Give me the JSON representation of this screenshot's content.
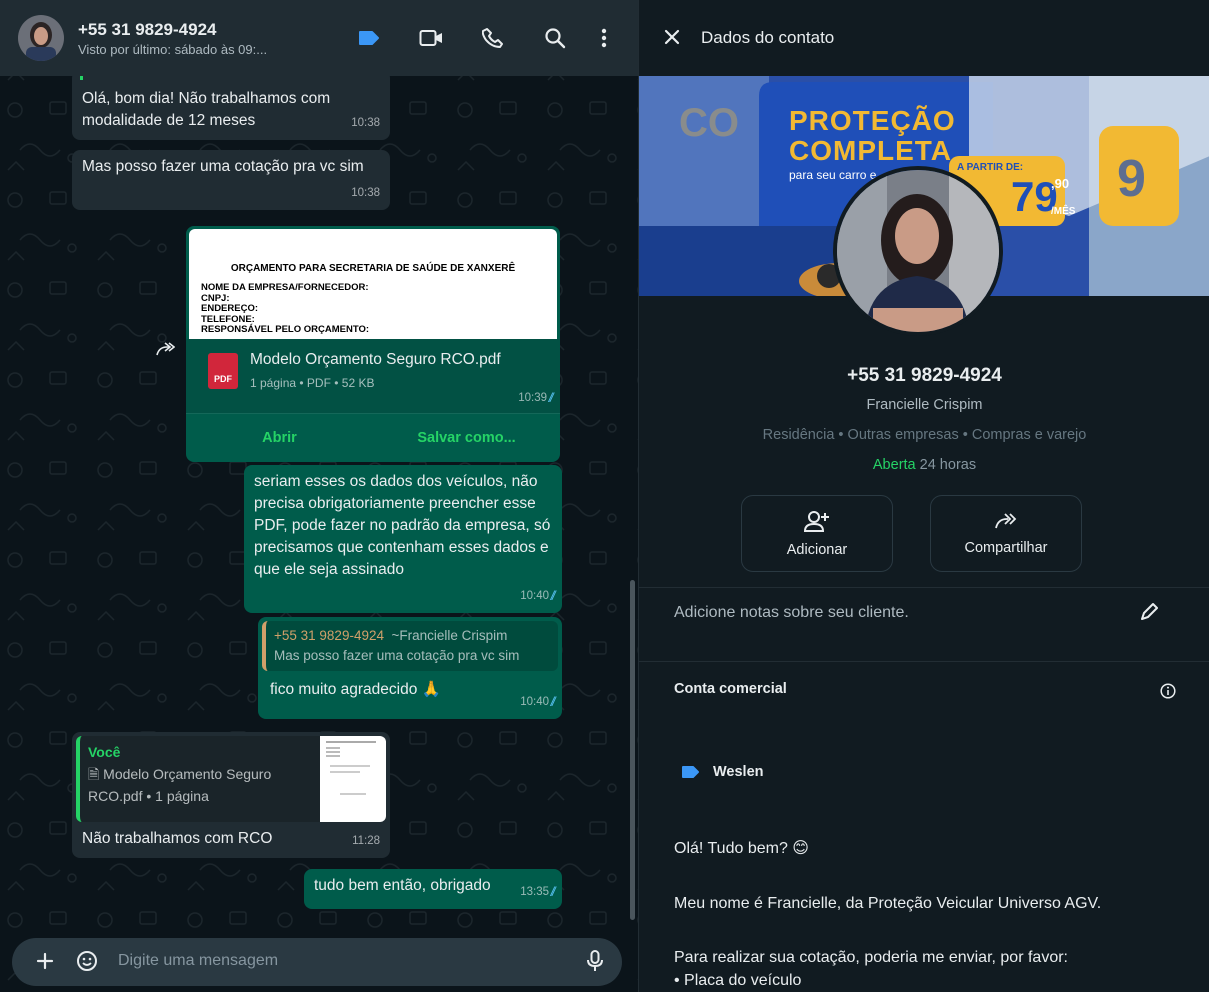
{
  "chat": {
    "contact_name": "+55 31 9829-4924",
    "last_seen": "Visto por último: sábado às 09:..."
  },
  "messages": {
    "m1_text": "Olá, bom dia! Não trabalhamos com modalidade de 12 meses",
    "m1_time": "10:38",
    "m2_text": "Mas posso fazer uma cotação pra vc sim",
    "m2_time": "10:38",
    "doc": {
      "preview_title": "ORÇAMENTO PARA SECRETARIA DE SAÚDE DE XANXERÊ",
      "preview_lines": [
        "NOME DA EMPRESA/FORNECEDOR:",
        "CNPJ:",
        "ENDEREÇO:",
        "TELEFONE:",
        "RESPONSÁVEL PELO ORÇAMENTO:"
      ],
      "icon_label": "PDF",
      "name": "Modelo Orçamento Seguro RCO.pdf",
      "meta": "1 página • PDF • 52 KB",
      "time": "10:39",
      "open_label": "Abrir",
      "save_label": "Salvar como..."
    },
    "m3_text": "seriam esses os dados dos veículos, não precisa obrigatoriamente preencher esse PDF, pode fazer no padrão da empresa, só precisamos que contenham esses dados e que ele seja assinado",
    "m3_time": "10:40",
    "m4_quote_author": "+55 31 9829-4924",
    "m4_quote_name": "~Francielle Crispim",
    "m4_quote_text": "Mas posso fazer uma cotação pra vc sim",
    "m4_text": "fico muito agradecido 🙏",
    "m4_time": "10:40",
    "m5_quote_author": "Você",
    "m5_quote_text": "Modelo Orçamento Seguro RCO.pdf • 1 página",
    "m5_text": "Não trabalhamos com RCO",
    "m5_time": "11:28",
    "m6_text": "tudo bem então, obrigado",
    "m6_time": "13:35"
  },
  "composer": {
    "placeholder": "Digite uma mensagem"
  },
  "panel": {
    "title": "Dados do contato",
    "banner_line1": "PROTEÇÃO",
    "banner_line2": "COMPLETA",
    "banner_line3": "para seu carro e",
    "banner_badge_top": "A PARTIR DE:",
    "banner_badge_cents": ",90",
    "banner_badge_unit": "/MÊS",
    "banner_price": "79",
    "phone": "+55 31 9829-4924",
    "real_name": "Francielle Crispim",
    "categories": "Residência • Outras empresas • Compras e varejo",
    "open_label": "Aberta",
    "hours": " 24 horas",
    "add_label": "Adicionar",
    "share_label": "Compartilhar",
    "notes_placeholder": "Adicione notas sobre seu cliente.",
    "business_label": "Conta comercial",
    "tag_label": "Weslen",
    "greeting": "Olá! Tudo bem? 😊",
    "intro": "Meu nome é Francielle, da Proteção Veicular Universo AGV.",
    "request": "Para realizar sua cotação, poderia me enviar, por favor:",
    "bullet1": "• Placa do veículo"
  },
  "colors": {
    "chat_bg": "#0b141a",
    "header_bg": "#202c33",
    "incoming": "#202c33",
    "outgoing": "#005c4b",
    "accent_green": "#25d366",
    "tick_blue": "#53bdeb",
    "label_blue": "#3b97f6"
  }
}
